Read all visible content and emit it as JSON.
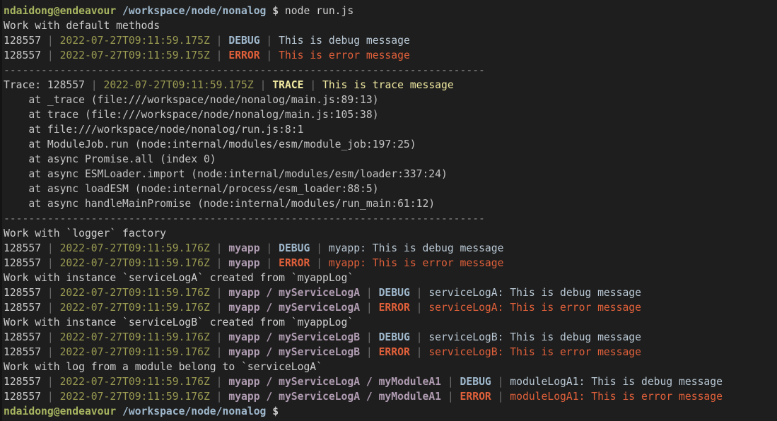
{
  "terminal": {
    "background": "#1e1e1e",
    "prompt": {
      "user_host": "ndaidong@endeavour",
      "path": "/workspace/node/nonalog",
      "symbol": "$",
      "command": " node run.js"
    },
    "colors": {
      "plain": "#cfcfcf",
      "timestamp": "#9a9a52",
      "pipe": "#6e6e6e",
      "debug": "#9fb8cc",
      "error": "#e0603a",
      "trace": "#efe8a0",
      "namespace": "#b09cb2",
      "user": "#a8b560",
      "path": "#9fb8cc"
    },
    "separator": "-----------------------------------------------------------------------------",
    "lines": [
      {
        "id": "prompt-line-top",
        "type": "prompt",
        "user_host": "ndaidong@endeavour",
        "path": "/workspace/node/nonalog",
        "symbol": "$",
        "command": " node run.js"
      },
      {
        "id": "section-default-methods",
        "type": "plain",
        "text": "Work with default methods"
      },
      {
        "id": "log-default-debug",
        "type": "log",
        "pid": "128557",
        "timestamp": "2022-07-27T09:11:59.175Z",
        "namespace": "",
        "level": "DEBUG",
        "message": "This is debug message"
      },
      {
        "id": "log-default-error",
        "type": "log",
        "pid": "128557",
        "timestamp": "2022-07-27T09:11:59.175Z",
        "namespace": "",
        "level": "ERROR",
        "message": "This is error message"
      },
      {
        "id": "separator-1",
        "type": "separator",
        "text": "-----------------------------------------------------------------------------"
      },
      {
        "id": "log-trace-header",
        "type": "trace",
        "prefix": "Trace: ",
        "pid": "128557",
        "timestamp": "2022-07-27T09:11:59.175Z",
        "level": "TRACE",
        "message": "This is trace message"
      },
      {
        "id": "stack-1",
        "type": "stack",
        "text": "    at _trace (file:///workspace/node/nonalog/main.js:89:13)"
      },
      {
        "id": "stack-2",
        "type": "stack",
        "text": "    at trace (file:///workspace/node/nonalog/main.js:105:38)"
      },
      {
        "id": "stack-3",
        "type": "stack",
        "text": "    at file:///workspace/node/nonalog/run.js:8:1"
      },
      {
        "id": "stack-4",
        "type": "stack",
        "text": "    at ModuleJob.run (node:internal/modules/esm/module_job:197:25)"
      },
      {
        "id": "stack-5",
        "type": "stack",
        "text": "    at async Promise.all (index 0)"
      },
      {
        "id": "stack-6",
        "type": "stack",
        "text": "    at async ESMLoader.import (node:internal/modules/esm/loader:337:24)"
      },
      {
        "id": "stack-7",
        "type": "stack",
        "text": "    at async loadESM (node:internal/process/esm_loader:88:5)"
      },
      {
        "id": "stack-8",
        "type": "stack",
        "text": "    at async handleMainPromise (node:internal/modules/run_main:61:12)"
      },
      {
        "id": "separator-2",
        "type": "separator",
        "text": "-----------------------------------------------------------------------------"
      },
      {
        "id": "section-logger-factory",
        "type": "plain",
        "text": "Work with `logger` factory"
      },
      {
        "id": "log-myapp-debug",
        "type": "log",
        "pid": "128557",
        "timestamp": "2022-07-27T09:11:59.176Z",
        "namespace": "myapp",
        "level": "DEBUG",
        "message": "myapp: This is debug message"
      },
      {
        "id": "log-myapp-error",
        "type": "log",
        "pid": "128557",
        "timestamp": "2022-07-27T09:11:59.176Z",
        "namespace": "myapp",
        "level": "ERROR",
        "message": "myapp: This is error message"
      },
      {
        "id": "section-servicelog-a",
        "type": "plain",
        "text": "Work with instance `serviceLogA` created from `myappLog`"
      },
      {
        "id": "log-servicea-debug",
        "type": "log",
        "pid": "128557",
        "timestamp": "2022-07-27T09:11:59.176Z",
        "namespace": "myapp / myServiceLogA",
        "level": "DEBUG",
        "message": "serviceLogA: This is debug message"
      },
      {
        "id": "log-servicea-error",
        "type": "log",
        "pid": "128557",
        "timestamp": "2022-07-27T09:11:59.176Z",
        "namespace": "myapp / myServiceLogA",
        "level": "ERROR",
        "message": "serviceLogA: This is error message"
      },
      {
        "id": "section-servicelog-b",
        "type": "plain",
        "text": "Work with instance `serviceLogB` created from `myappLog`"
      },
      {
        "id": "log-serviceb-debug",
        "type": "log",
        "pid": "128557",
        "timestamp": "2022-07-27T09:11:59.176Z",
        "namespace": "myapp / myServiceLogB",
        "level": "DEBUG",
        "message": "serviceLogB: This is debug message"
      },
      {
        "id": "log-serviceb-error",
        "type": "log",
        "pid": "128557",
        "timestamp": "2022-07-27T09:11:59.176Z",
        "namespace": "myapp / myServiceLogB",
        "level": "ERROR",
        "message": "serviceLogB: This is error message"
      },
      {
        "id": "section-module-log",
        "type": "plain",
        "text": "Work with log from a module belong to `serviceLogA`"
      },
      {
        "id": "log-modulea1-debug",
        "type": "log",
        "pid": "128557",
        "timestamp": "2022-07-27T09:11:59.176Z",
        "namespace": "myapp / myServiceLogA / myModuleA1",
        "level": "DEBUG",
        "message": "moduleLogA1: This is debug message"
      },
      {
        "id": "log-modulea1-error",
        "type": "log",
        "pid": "128557",
        "timestamp": "2022-07-27T09:11:59.176Z",
        "namespace": "myapp / myServiceLogA / myModuleA1",
        "level": "ERROR",
        "message": "moduleLogA1: This is error message"
      },
      {
        "id": "prompt-line-bottom",
        "type": "prompt",
        "user_host": "ndaidong@endeavour",
        "path": "/workspace/node/nonalog",
        "symbol": "$",
        "command": ""
      }
    ]
  }
}
